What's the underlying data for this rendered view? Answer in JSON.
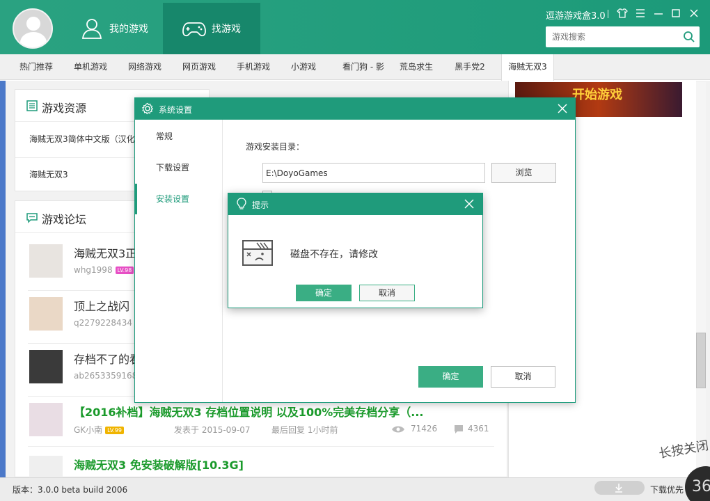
{
  "header": {
    "tabs": [
      {
        "label": "我的游戏",
        "icon": "user-icon",
        "active": false
      },
      {
        "label": "找游戏",
        "icon": "gamepad-icon",
        "active": true
      }
    ],
    "app_title": "逗游游戏盒3.0",
    "window_buttons": [
      "shirt-icon",
      "menu-icon",
      "minimize-icon",
      "maximize-icon",
      "close-icon"
    ],
    "search_placeholder": "游戏搜索"
  },
  "categories": [
    {
      "label": "热门推荐"
    },
    {
      "label": "单机游戏"
    },
    {
      "label": "网络游戏"
    },
    {
      "label": "网页游戏"
    },
    {
      "label": "手机游戏"
    },
    {
      "label": "小游戏"
    },
    {
      "label": "看门狗 - 影"
    },
    {
      "label": "荒岛求生"
    },
    {
      "label": "黑手党2"
    },
    {
      "label": "海贼无双3",
      "active": true
    }
  ],
  "resources": {
    "title": "游戏资源",
    "items": [
      "海贼无双3简体中文版（汉化",
      "海贼无双3"
    ]
  },
  "forum": {
    "title": "游戏论坛",
    "posts": [
      {
        "title": "海贼无双3正",
        "author": "whg1998",
        "level": "LV.98",
        "level_color": "pink"
      },
      {
        "title": "顶上之战闪",
        "author": "q2279228434",
        "level": "",
        "level_color": "yellow"
      },
      {
        "title": "存档不了的看",
        "author": "ab2653359168",
        "level": "",
        "level_color": ""
      },
      {
        "title": "【2016补档】海贼无双3 存档位置说明 以及100%完美存档分享（...",
        "author": "GK小南",
        "level": "LV.99",
        "level_color": "yellow",
        "posted": "发表于 2015-09-07",
        "last_reply": "最后回复 1小时前",
        "views": "71426",
        "replies": "4361",
        "highlight": true
      },
      {
        "title": "海贼无双3 免安装破解版[10.3G]",
        "highlight": true
      }
    ]
  },
  "banner_text": "开始游戏",
  "overlay_text": "长按关闭",
  "status": {
    "version": "版本：3.0.0 beta build 2006",
    "download_label": "下载优先",
    "corner_badge": "36"
  },
  "settings_dialog": {
    "title": "系统设置",
    "side_items": [
      {
        "label": "常规"
      },
      {
        "label": "下载设置"
      },
      {
        "label": "安装设置",
        "active": true
      }
    ],
    "install_dir_label": "游戏安装目录：",
    "install_dir_value": "E:\\DoyoGames",
    "browse_label": "浏览",
    "ok_label": "确定",
    "cancel_label": "取消"
  },
  "alert_dialog": {
    "title": "提示",
    "message": "磁盘不存在，请修改",
    "ok_label": "确定",
    "cancel_label": "取消"
  }
}
